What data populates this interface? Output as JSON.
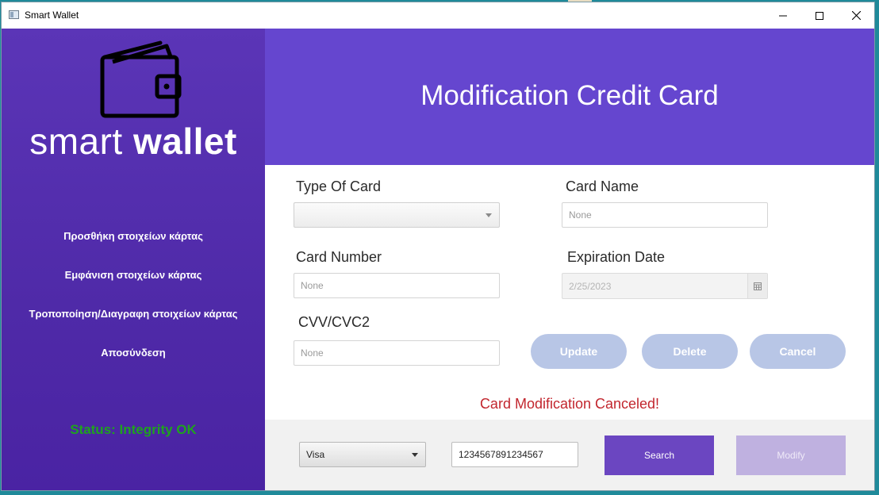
{
  "window": {
    "title": "Smart Wallet",
    "app_icon": "window-app-icon",
    "controls": [
      "minimize-icon",
      "maximize-icon",
      "close-icon"
    ]
  },
  "sidebar": {
    "logo_icon": "wallet-icon",
    "logo_word_1": "smart",
    "logo_word_2": "wallet",
    "menu": [
      "Προσθήκη στοιχείων κάρτας",
      "Εμφάνιση στοιχείων κάρτας",
      "Τροποποίηση/Διαγραφη στοιχείων κάρτας",
      "Αποσύνδεση"
    ],
    "status": "Status: Integrity OK"
  },
  "header": {
    "title": "Modification Credit Card"
  },
  "form": {
    "type_of_card_label": "Type Of Card",
    "type_of_card_value": "",
    "card_name_label": "Card Name",
    "card_name_placeholder": "None",
    "card_number_label": "Card Number",
    "card_number_placeholder": "None",
    "expiration_date_label": "Expiration Date",
    "expiration_date_value": "2/25/2023",
    "calendar_icon": "calendar-icon",
    "cvv_label": "CVV/CVC2",
    "cvv_placeholder": "None"
  },
  "actions": {
    "update": "Update",
    "delete": "Delete",
    "cancel": "Cancel"
  },
  "message": "Card Modification Canceled!",
  "search_bar": {
    "card_type_selected": "Visa",
    "card_number_value": "1234567891234567",
    "search_label": "Search",
    "modify_label": "Modify"
  },
  "colors": {
    "sidebar": "#5330b0",
    "header": "#6546cf",
    "status": "#1fa21f",
    "message": "#c2262e",
    "pill_button": "#b8c6e6",
    "search_button": "#6b46c1",
    "modify_button_disabled": "#bfb1e0"
  }
}
